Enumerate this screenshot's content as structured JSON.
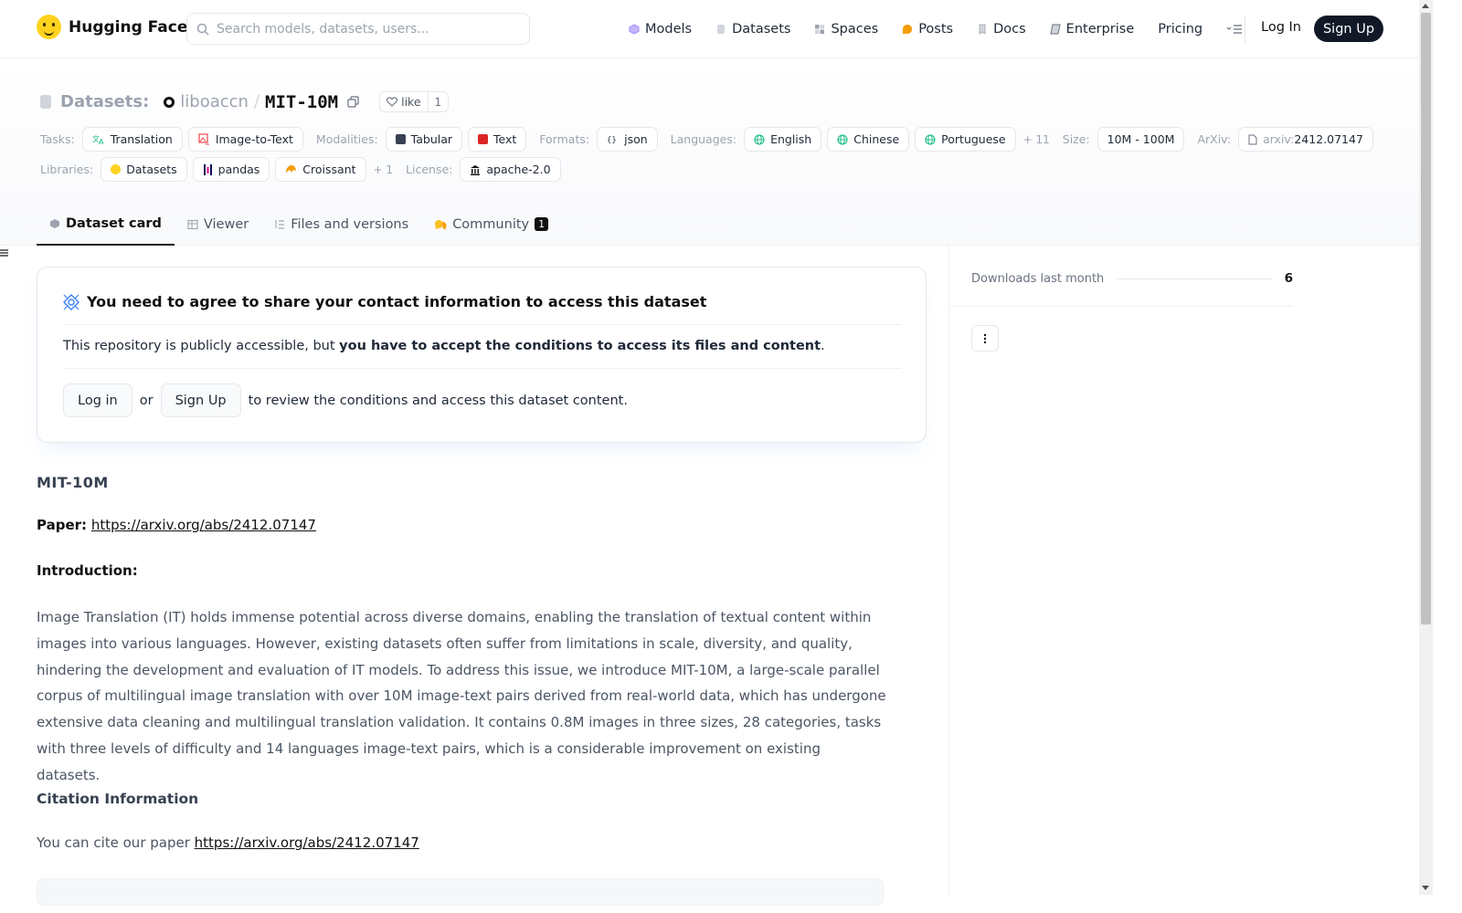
{
  "nav": {
    "brand": "Hugging Face",
    "search_placeholder": "Search models, datasets, users...",
    "links": [
      {
        "label": "Models",
        "icon": "model-icon",
        "color": "#a78bfa"
      },
      {
        "label": "Datasets",
        "icon": "dataset-icon",
        "color": "#d1d5db"
      },
      {
        "label": "Spaces",
        "icon": "spaces-icon",
        "color": "#9ca3af"
      },
      {
        "label": "Posts",
        "icon": "posts-icon",
        "color": "#f59e0b"
      },
      {
        "label": "Docs",
        "icon": "docs-icon",
        "color": "#9ca3af"
      },
      {
        "label": "Enterprise",
        "icon": "enterprise-icon",
        "color": "#6b7280"
      },
      {
        "label": "Pricing"
      }
    ],
    "login": "Log In",
    "signup": "Sign Up"
  },
  "header": {
    "section": "Datasets:",
    "owner": "liboaccn",
    "slash": "/",
    "repo": "MIT-10M",
    "like_label": "like",
    "like_count": "1",
    "tasks_label": "Tasks:",
    "tasks": [
      "Translation",
      "Image-to-Text"
    ],
    "modalities_label": "Modalities:",
    "modalities": [
      "Tabular",
      "Text"
    ],
    "formats_label": "Formats:",
    "formats": [
      "json"
    ],
    "languages_label": "Languages:",
    "languages": [
      "English",
      "Chinese",
      "Portuguese"
    ],
    "languages_more": "+ 11",
    "size_label": "Size:",
    "size": "10M - 100M",
    "arxiv_label": "ArXiv:",
    "arxiv_prefix": "arxiv:",
    "arxiv_id": "2412.07147",
    "libraries_label": "Libraries:",
    "libraries": [
      "Datasets",
      "pandas",
      "Croissant"
    ],
    "libraries_more": "+ 1",
    "license_label": "License:",
    "license": "apache-2.0"
  },
  "tabs": [
    {
      "label": "Dataset card",
      "active": true
    },
    {
      "label": "Viewer"
    },
    {
      "label": "Files and versions"
    },
    {
      "label": "Community",
      "badge": "1"
    }
  ],
  "gate": {
    "title": "You need to agree to share your contact information to access this dataset",
    "text_plain": "This repository is publicly accessible, but ",
    "text_bold": "you have to accept the conditions to access its files and content",
    "text_end": ".",
    "login_btn": "Log in",
    "or": "or",
    "signup_btn": "Sign Up",
    "after": "to review the conditions and access this dataset content."
  },
  "card": {
    "heading": "MIT-10M",
    "paper_label": "Paper:",
    "paper_link": "https://arxiv.org/abs/2412.07147",
    "intro_heading": "Introduction:",
    "intro_body": "Image Translation (IT) holds immense potential across diverse domains, enabling the translation of textual content within images into various languages. However, existing datasets often suffer from limitations in scale, diversity, and quality, hindering the development and evaluation of IT models. To address this issue, we introduce MIT-10M, a large-scale parallel corpus of multilingual image translation with over 10M image-text pairs derived from real-world data, which has undergone extensive data cleaning and multilingual translation validation. It contains 0.8M images in three sizes, 28 categories, tasks with three levels of difficulty and 14 languages image-text pairs, which is a considerable improvement on existing datasets.",
    "cite_heading": "Citation Information",
    "cite_text": "You can cite our paper ",
    "cite_link": "https://arxiv.org/abs/2412.07147"
  },
  "sidebar": {
    "downloads_label": "Downloads last month",
    "downloads_value": "6"
  }
}
